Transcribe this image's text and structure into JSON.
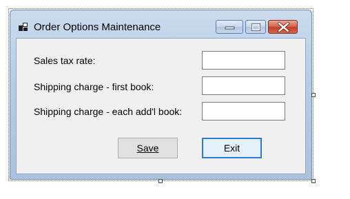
{
  "window": {
    "title": "Order Options Maintenance",
    "icon": "form-icon"
  },
  "caption_buttons": {
    "minimize_icon": "minimize-icon",
    "maximize_icon": "maximize-icon",
    "close_icon": "close-icon"
  },
  "form": {
    "fields": [
      {
        "label": "Sales tax rate:",
        "value": ""
      },
      {
        "label": "Shipping charge - first book:",
        "value": ""
      },
      {
        "label": "Shipping charge - each add'l book:",
        "value": ""
      }
    ],
    "buttons": {
      "save_label": "Save",
      "exit_label": "Exit"
    }
  },
  "colors": {
    "close_button": "#c4402a",
    "focused_button_border": "#2d7ad0"
  }
}
